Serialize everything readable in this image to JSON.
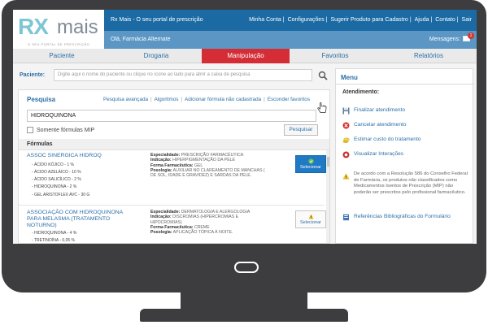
{
  "logo": {
    "rx": "RX",
    "mais": "mais",
    "tagline": "O SEU PORTAL DE PRESCRIÇÃO"
  },
  "topbar": {
    "portal_text": "Rx Mais - O seu portal de prescrição",
    "links": [
      "Minha Conta",
      "Configurações",
      "Sugerir Produto para Cadastro",
      "Ajuda",
      "Contato",
      "Sair"
    ],
    "greeting": "Olá, Farmácia Alternate",
    "messages_label": "Mensagens:",
    "messages_count": "1"
  },
  "tabs": [
    "Paciente",
    "Drogaria",
    "Manipulação",
    "Favoritos",
    "Relatórios"
  ],
  "active_tab": "Manipulação",
  "patient": {
    "label": "Paciente:",
    "placeholder": "Digite aqui o nome do paciente ou clique no ícone ao lado para abrir a caixa de pesquisa"
  },
  "search": {
    "title": "Pesquisa",
    "links": [
      "Pesquisa avançada",
      "Algoritmos",
      "Adicionar fórmula não cadastrada",
      "Esconder favoritos"
    ],
    "query": "HIDROQUINONA",
    "mip_label": "Somente fórmulas MIP",
    "button": "Pesquisar"
  },
  "formulas": {
    "header": "Fórmulas",
    "rows": [
      {
        "name": "ASSOC SINERGICA HIDROQ",
        "components": [
          "- ÁCIDO KÓJICO - 1 %",
          "- ÁCIDO AZELÁICO - 10 %",
          "- ÁCIDO SALICÍLICO - 2 %",
          "- HIDROQUINONA - 2 %",
          "- GEL ARISTOFLEX AVC - 30 G"
        ],
        "especialidade_label": "Especialidade:",
        "especialidade": "PRESCRIÇÃO FARMACÊUTICA",
        "indicacao_label": "Indicação:",
        "indicacao": "HIPERPIGMENTAÇÃO DA PELE",
        "forma_label": "Forma Farmacêutica:",
        "forma": "GEL",
        "posologia_label": "Posologia:",
        "posologia": "AUXILIAR NO CLAREAMENTO DE MANCHAS ( DE SOL, IDADE E GRAVIDEZ) E SARDAS DA PELE.",
        "select_label": "Selecionar",
        "status": "ok"
      },
      {
        "name": "ASSOCIAÇÃO COM HIDROQUINONA PARA MELASMA (TRATAMENTO NOTURNO)",
        "components": [
          "- HIDROQUINONA - 4 %",
          "- TRETINOÍNA - 0,05 %"
        ],
        "especialidade_label": "Especialidade:",
        "especialidade": "DERMATOLOGIA E ALERGOLOGIA",
        "indicacao_label": "Indicação:",
        "indicacao": "DISCROMIAS (HIPERCROMIAS E HIPOCROMIAS)",
        "forma_label": "Forma Farmacêutica:",
        "forma": "CREME",
        "posologia_label": "Posologia:",
        "posologia": "APLICAÇÃO TÓPICA À NOITE.",
        "select_label": "Selecionar",
        "status": "warning"
      }
    ]
  },
  "menu": {
    "title": "Menu",
    "section": "Atendimento:",
    "items": [
      {
        "label": "Finalizar atendimento",
        "icon": "save-icon"
      },
      {
        "label": "Cancelar atendimento",
        "icon": "cancel-icon"
      },
      {
        "label": "Estimar custo do tratamento",
        "icon": "coins-icon"
      },
      {
        "label": "Visualizar Interações",
        "icon": "interactions-icon"
      }
    ],
    "notice": "De acordo com a Resolução 586 do Conselho Federal de Farmácia, os produtos não classificados como Medicamentos Isentos de Prescrição (MIP) não poderão ser prescritos pelo profissional farmacêutico.",
    "references": "Referências Bibliográficas do Formulário"
  },
  "colors": {
    "primary": "#1b6aa4",
    "secondary": "#5b96c4",
    "accent": "#d42d35",
    "link": "#2c6fa6",
    "monitor": "#3d3d3f"
  }
}
